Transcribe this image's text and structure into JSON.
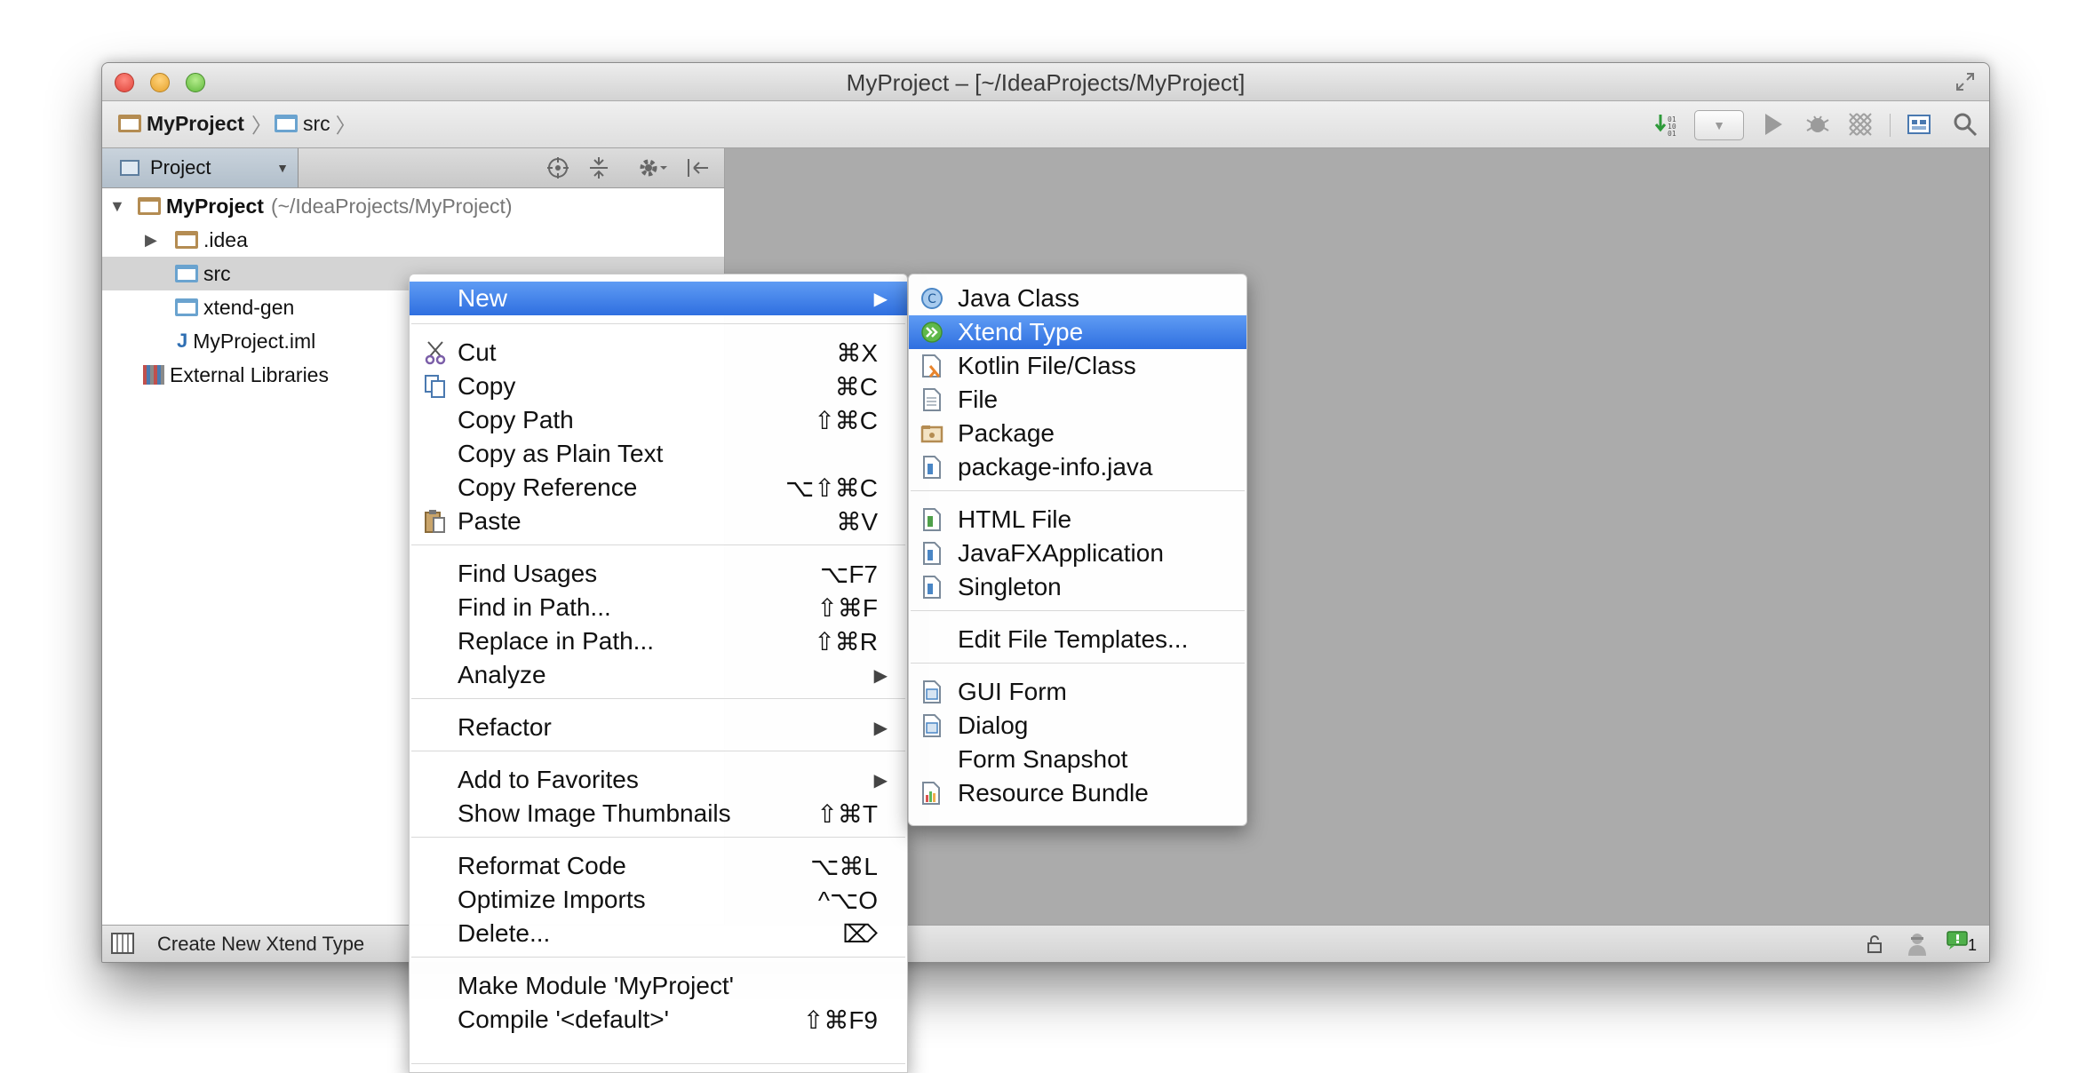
{
  "window": {
    "title": "MyProject – [~/IdeaProjects/MyProject]"
  },
  "breadcrumb": {
    "project": "MyProject",
    "folder": "src"
  },
  "project_panel": {
    "view_selector": "Project",
    "tree": [
      {
        "label": "MyProject",
        "suffix": "(~/IdeaProjects/MyProject)"
      },
      {
        "label": ".idea"
      },
      {
        "label": "src"
      },
      {
        "label": "xtend-gen"
      },
      {
        "label": "MyProject.iml"
      },
      {
        "label": "External Libraries"
      }
    ]
  },
  "context_menu": {
    "items": [
      {
        "label": "New",
        "shortcut": ""
      },
      {
        "label": "Cut",
        "shortcut": "⌘X"
      },
      {
        "label": "Copy",
        "shortcut": "⌘C"
      },
      {
        "label": "Copy Path",
        "shortcut": "⇧⌘C"
      },
      {
        "label": "Copy as Plain Text",
        "shortcut": ""
      },
      {
        "label": "Copy Reference",
        "shortcut": "⌥⇧⌘C"
      },
      {
        "label": "Paste",
        "shortcut": "⌘V"
      },
      {
        "label": "Find Usages",
        "shortcut": "⌥F7"
      },
      {
        "label": "Find in Path...",
        "shortcut": "⇧⌘F"
      },
      {
        "label": "Replace in Path...",
        "shortcut": "⇧⌘R"
      },
      {
        "label": "Analyze",
        "shortcut": ""
      },
      {
        "label": "Refactor",
        "shortcut": ""
      },
      {
        "label": "Add to Favorites",
        "shortcut": ""
      },
      {
        "label": "Show Image Thumbnails",
        "shortcut": "⇧⌘T"
      },
      {
        "label": "Reformat Code",
        "shortcut": "⌥⌘L"
      },
      {
        "label": "Optimize Imports",
        "shortcut": "^⌥O"
      },
      {
        "label": "Delete...",
        "shortcut": "⌦"
      },
      {
        "label": "Make Module 'MyProject'",
        "shortcut": ""
      },
      {
        "label": "Compile '<default>'",
        "shortcut": "⇧⌘F9"
      }
    ]
  },
  "new_submenu": {
    "items": [
      {
        "label": "Java Class",
        "icon": "java-class-icon"
      },
      {
        "label": "Xtend Type",
        "icon": "xtend-icon"
      },
      {
        "label": "Kotlin File/Class",
        "icon": "kotlin-file-icon"
      },
      {
        "label": "File",
        "icon": "file-icon"
      },
      {
        "label": "Package",
        "icon": "package-icon"
      },
      {
        "label": "package-info.java",
        "icon": "java-file-icon"
      },
      {
        "label": "HTML File",
        "icon": "html-file-icon"
      },
      {
        "label": "JavaFXApplication",
        "icon": "java-file-icon"
      },
      {
        "label": "Singleton",
        "icon": "java-file-icon"
      },
      {
        "label": "Edit File Templates...",
        "icon": ""
      },
      {
        "label": "GUI Form",
        "icon": "form-icon"
      },
      {
        "label": "Dialog",
        "icon": "form-icon"
      },
      {
        "label": "Form Snapshot",
        "icon": ""
      },
      {
        "label": "Resource Bundle",
        "icon": "resource-bundle-icon"
      }
    ]
  },
  "status_bar": {
    "message": "Create New Xtend Type",
    "badge_count": "1"
  },
  "colors": {
    "menu_highlight": "#3e7ee8",
    "editor_background": "#ababab"
  }
}
